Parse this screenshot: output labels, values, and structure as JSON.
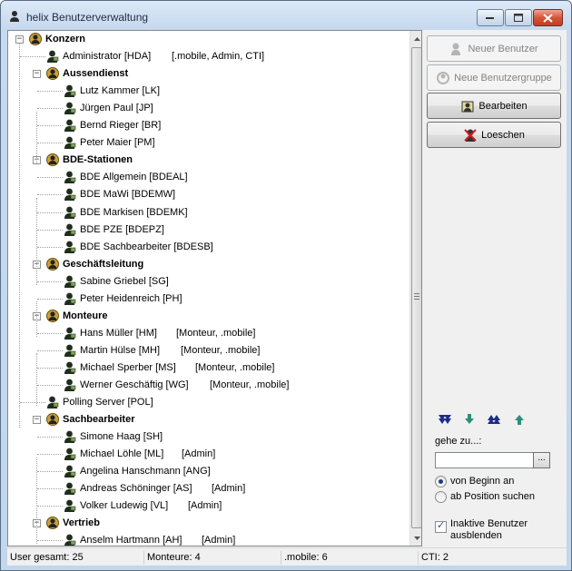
{
  "window": {
    "title": "helix Benutzerverwaltung",
    "icon": "key-user-icon"
  },
  "tree": {
    "nodes": [
      {
        "label": "Konzern",
        "type": "group",
        "expanded": true
      },
      {
        "label": "Administrator [HDA]",
        "extra": "[.mobile, Admin, CTI]",
        "type": "user"
      },
      {
        "label": "Aussendienst",
        "type": "group",
        "expanded": true
      },
      {
        "label": "Lutz Kammer [LK]",
        "extra": "",
        "type": "user"
      },
      {
        "label": "Jürgen Paul [JP]",
        "extra": "",
        "type": "user"
      },
      {
        "label": "Bernd Rieger [BR]",
        "extra": "",
        "type": "user"
      },
      {
        "label": "Peter Maier [PM]",
        "extra": "",
        "type": "user"
      },
      {
        "label": "BDE-Stationen",
        "type": "group",
        "expanded": true
      },
      {
        "label": "BDE Allgemein [BDEAL]",
        "extra": "",
        "type": "user"
      },
      {
        "label": "BDE MaWi [BDEMW]",
        "extra": "",
        "type": "user"
      },
      {
        "label": "BDE Markisen [BDEMK]",
        "extra": "",
        "type": "user"
      },
      {
        "label": "BDE PZE [BDEPZ]",
        "extra": "",
        "type": "user"
      },
      {
        "label": "BDE Sachbearbeiter [BDESB]",
        "extra": "",
        "type": "user"
      },
      {
        "label": "Geschäftsleitung",
        "type": "group",
        "expanded": true
      },
      {
        "label": "Sabine Griebel [SG]",
        "extra": "",
        "type": "user"
      },
      {
        "label": "Peter Heidenreich [PH]",
        "extra": "",
        "type": "user"
      },
      {
        "label": "Monteure",
        "type": "group",
        "expanded": true
      },
      {
        "label": "Hans Müller [HM]",
        "extra": "[Monteur, .mobile]",
        "type": "user"
      },
      {
        "label": "Martin Hülse [MH]",
        "extra": "[Monteur, .mobile]",
        "type": "user"
      },
      {
        "label": "Michael Sperber [MS]",
        "extra": "[Monteur, .mobile]",
        "type": "user"
      },
      {
        "label": "Werner Geschäftig [WG]",
        "extra": "[Monteur, .mobile]",
        "type": "user"
      },
      {
        "label": "Polling Server [POL]",
        "extra": "",
        "type": "user"
      },
      {
        "label": "Sachbearbeiter",
        "type": "group",
        "expanded": true
      },
      {
        "label": "Simone Haag [SH]",
        "extra": "",
        "type": "user"
      },
      {
        "label": "Michael Löhle [ML]",
        "extra": "[Admin]",
        "type": "user"
      },
      {
        "label": "Angelina Hanschmann [ANG]",
        "extra": "",
        "type": "user"
      },
      {
        "label": "Andreas Schöninger [AS]",
        "extra": "[Admin]",
        "type": "user"
      },
      {
        "label": "Volker Ludewig [VL]",
        "extra": "[Admin]",
        "type": "user"
      },
      {
        "label": "Vertrieb",
        "type": "group",
        "expanded": true
      },
      {
        "label": "Anselm Hartmann [AH]",
        "extra": "[Admin]",
        "type": "user"
      }
    ]
  },
  "actions": {
    "new_user": "Neuer Benutzer",
    "new_group": "Neue Benutzergruppe",
    "edit": "Bearbeiten",
    "delete": "Loeschen"
  },
  "navigation": {
    "arrows": [
      "last-down-icon",
      "next-down-icon",
      "first-up-icon",
      "prev-up-icon"
    ],
    "goto_label": "gehe zu...:",
    "goto_value": "",
    "goto_button": "...",
    "radio_from_start": "von Beginn an",
    "radio_from_position": "ab Position suchen",
    "selected_radio": "from_start",
    "hide_inactive_label": "Inaktive Benutzer ausblenden",
    "hide_inactive_checked": true
  },
  "status": {
    "user_total": "User gesamt: 25",
    "monteure": "Monteure: 4",
    "mobile": ".mobile: 6",
    "cti": "CTI: 2"
  },
  "colors": {
    "group_icon": "#c8a13a",
    "user_icon": "#1f2e1c",
    "nav_arrow_dark": "#1b2c8a",
    "nav_arrow_teal": "#2a8f7a"
  }
}
